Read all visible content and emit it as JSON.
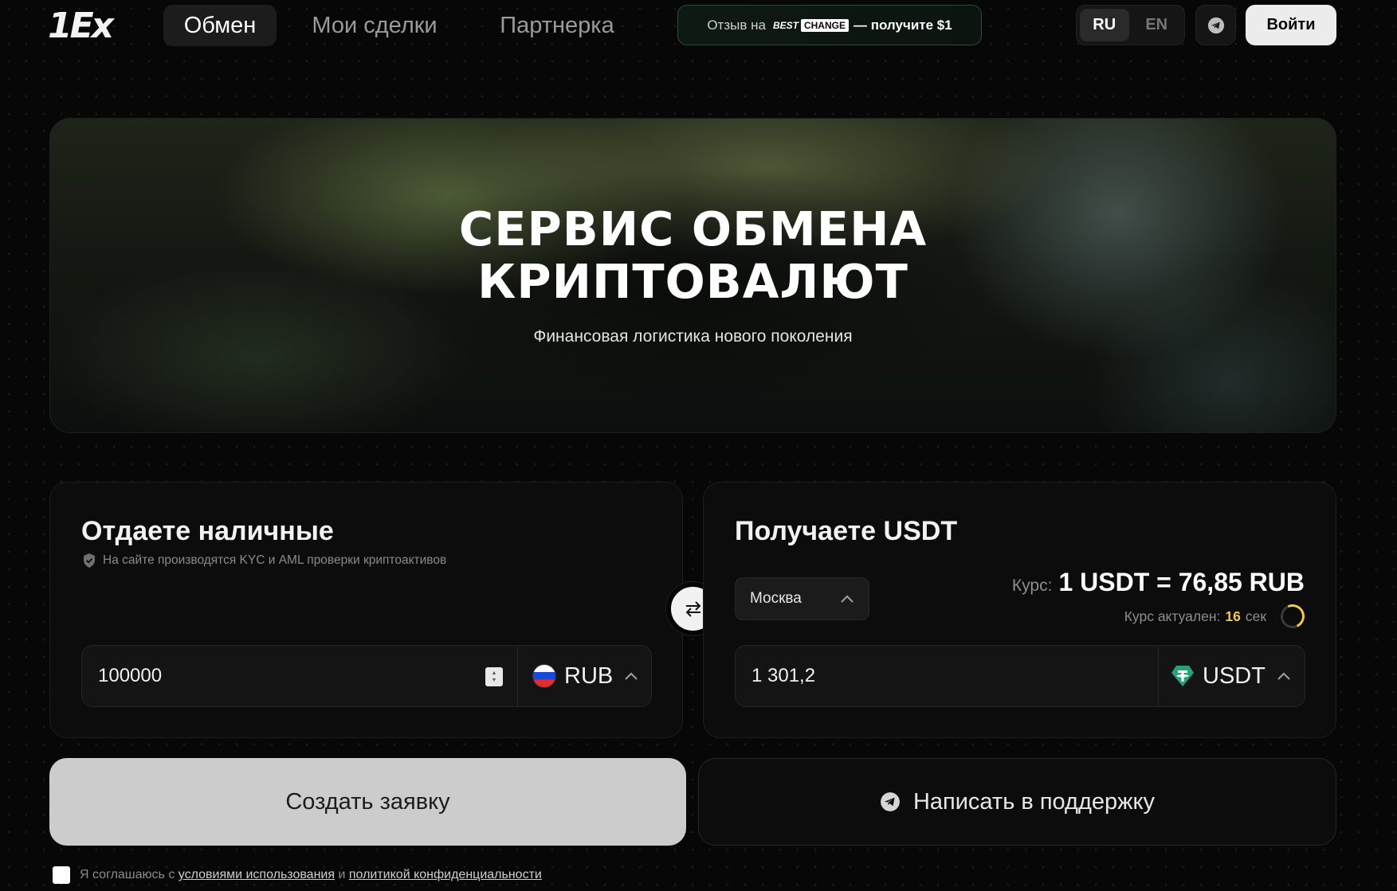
{
  "header": {
    "logo_text": "1Ex",
    "nav": [
      {
        "label": "Обмен",
        "active": true
      },
      {
        "label": "Мои сделки",
        "active": false
      },
      {
        "label": "Партнерка",
        "active": false
      }
    ],
    "promo": {
      "prefix": "Отзыв на",
      "brand_best": "BEST",
      "brand_change": "CHANGE",
      "reward": "— получите $1"
    },
    "languages": [
      {
        "label": "RU",
        "active": true
      },
      {
        "label": "EN",
        "active": false
      }
    ],
    "telegram_icon": "telegram-icon",
    "login_label": "Войти"
  },
  "hero": {
    "title": "СЕРВИС ОБМЕНА\nКРИПТОВАЛЮТ",
    "subtitle": "Финансовая логистика нового поколения"
  },
  "give": {
    "title": "Отдаете наличные",
    "kyc_note": "На сайте производятся KYC и AML проверки криптоактивов",
    "amount": "100000",
    "currency": "RUB"
  },
  "get": {
    "title": "Получаете USDT",
    "city": "Москва",
    "rate_label": "Курс:",
    "rate_value": "1 USDT = 76,85 RUB",
    "rate_fresh_label": "Курс актуален:",
    "rate_fresh_seconds": "16",
    "rate_fresh_unit": "сек",
    "amount": "1 301,2",
    "currency": "USDT"
  },
  "actions": {
    "create_label": "Создать заявку",
    "support_label": "Написать в поддержку"
  },
  "consent": {
    "prefix": "Я соглашаюсь с",
    "terms_link": "условиями использования",
    "and": "и",
    "privacy_link": "политикой конфиденциальности"
  },
  "colors": {
    "accent_yellow": "#f2c94c",
    "tether_green": "#26a17b",
    "primary_button": "#cccccc"
  }
}
